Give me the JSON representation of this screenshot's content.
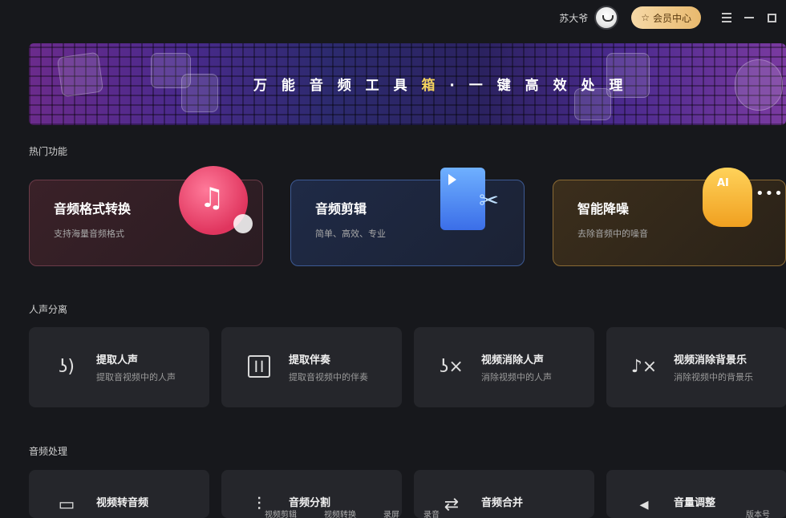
{
  "topbar": {
    "username": "苏大爷",
    "vip_label": "会员中心"
  },
  "banner": {
    "title_prefix": "万 能 音 频 工 具 ",
    "title_highlight": "箱",
    "title_suffix": " · 一 键 高 效 处 理"
  },
  "sections": {
    "hot": "热门功能",
    "vocal": "人声分离",
    "audio": "音频处理"
  },
  "hot_cards": [
    {
      "title": "音频格式转换",
      "subtitle": "支持海量音频格式"
    },
    {
      "title": "音频剪辑",
      "subtitle": "简单、高效、专业"
    },
    {
      "title": "智能降噪",
      "subtitle": "去除音频中的噪音",
      "badge": "AI"
    }
  ],
  "vocal_tools": [
    {
      "title": "提取人声",
      "subtitle": "提取音视频中的人声"
    },
    {
      "title": "提取伴奏",
      "subtitle": "提取音视频中的伴奏"
    },
    {
      "title": "视频消除人声",
      "subtitle": "消除视频中的人声"
    },
    {
      "title": "视频消除背景乐",
      "subtitle": "消除视频中的背景乐"
    }
  ],
  "audio_tools": [
    {
      "title": "视频转音频"
    },
    {
      "title": "音频分割"
    },
    {
      "title": "音频合并"
    },
    {
      "title": "音量调整"
    }
  ],
  "status_bar": {
    "items": [
      "视频剪辑",
      "视频转换",
      "录屏",
      "录音"
    ],
    "version": "版本号"
  },
  "colors": {
    "background": "#17181c",
    "card": "#25262b",
    "vip_gold": "#e8b96e",
    "accent_pink": "#e0355e",
    "accent_blue": "#3b6ee8",
    "accent_orange": "#f0a020"
  }
}
